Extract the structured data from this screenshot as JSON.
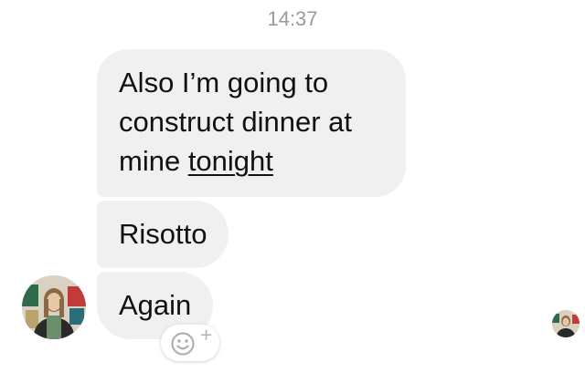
{
  "conversation": {
    "timestamp": "14:37",
    "messages": [
      {
        "line1": "Also I’m going to",
        "line2": "construct dinner at",
        "line3_prefix": "mine ",
        "line3_link": "tonight"
      },
      {
        "text": "Risotto"
      },
      {
        "text": "Again"
      }
    ]
  },
  "reaction": {
    "icon": "smiley-icon",
    "plus": "+"
  },
  "colors": {
    "bubble_bg": "#f0f0f0",
    "timestamp": "#9a9a9f",
    "text": "#111111"
  }
}
